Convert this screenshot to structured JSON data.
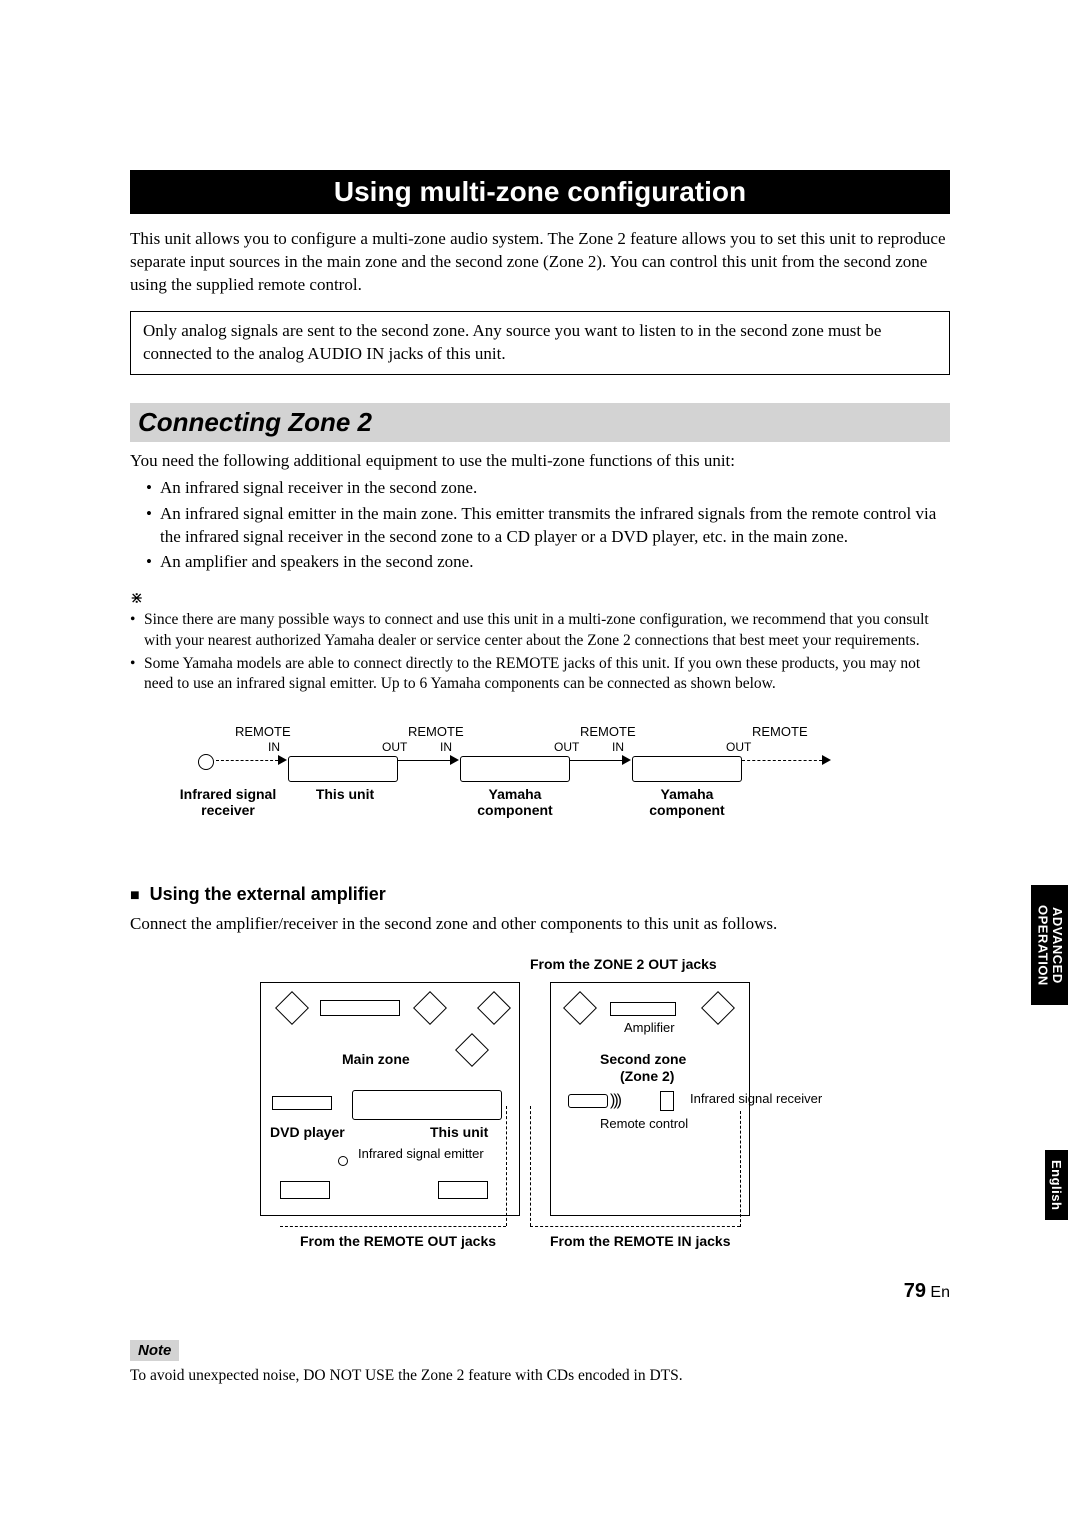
{
  "title": "Using multi-zone configuration",
  "intro": "This unit allows you to configure a multi-zone audio system. The Zone 2 feature allows you to set this unit to reproduce separate input sources in the main zone and the second zone (Zone 2). You can control this unit from the second zone using the supplied remote control.",
  "info_box": "Only analog signals are sent to the second zone. Any source you want to listen to in the second zone must be connected to the analog AUDIO IN jacks of this unit.",
  "section1": {
    "heading": "Connecting Zone 2",
    "lead": "You need the following additional equipment to use the multi-zone functions of this unit:",
    "bullets": [
      "An infrared signal receiver in the second zone.",
      "An infrared signal emitter in the main zone. This emitter transmits the infrared signals from the remote control via the infrared signal receiver in the second zone to a CD player or a DVD player, etc. in the main zone.",
      "An amplifier and speakers in the second zone."
    ],
    "notes": [
      "Since there are many possible ways to connect and use this unit in a multi-zone configuration, we recommend that you consult with your nearest authorized Yamaha dealer or service center about the Zone 2 connections that best meet your requirements.",
      "Some Yamaha models are able to connect directly to the REMOTE jacks of this unit. If you own these products, you may not need to use an infrared signal emitter. Up to 6 Yamaha components can be connected as shown below."
    ]
  },
  "diagram1": {
    "remote": "REMOTE",
    "in": "IN",
    "out": "OUT",
    "labels": [
      "Infrared signal receiver",
      "This unit",
      "Yamaha component",
      "Yamaha component"
    ]
  },
  "subheading": "Using the external amplifier",
  "subtext": "Connect the amplifier/receiver in the second zone and other components to this unit as follows.",
  "diagram2": {
    "top_label": "From the ZONE 2 OUT jacks",
    "main_zone": "Main zone",
    "second_zone_l1": "Second zone",
    "second_zone_l2": "(Zone 2)",
    "amplifier": "Amplifier",
    "dvd": "DVD player",
    "this_unit": "This unit",
    "ir_emitter": "Infrared signal emitter",
    "ir_receiver": "Infrared signal receiver",
    "remote_control": "Remote control",
    "bottom_left": "From the REMOTE OUT jacks",
    "bottom_right": "From the REMOTE IN jacks"
  },
  "note_label": "Note",
  "note_text": "To avoid unexpected noise, DO NOT USE the Zone 2 feature with CDs encoded in DTS.",
  "side_tab1_l1": "ADVANCED",
  "side_tab1_l2": "OPERATION",
  "side_tab2": "English",
  "page_number": "79",
  "page_lang": "En"
}
